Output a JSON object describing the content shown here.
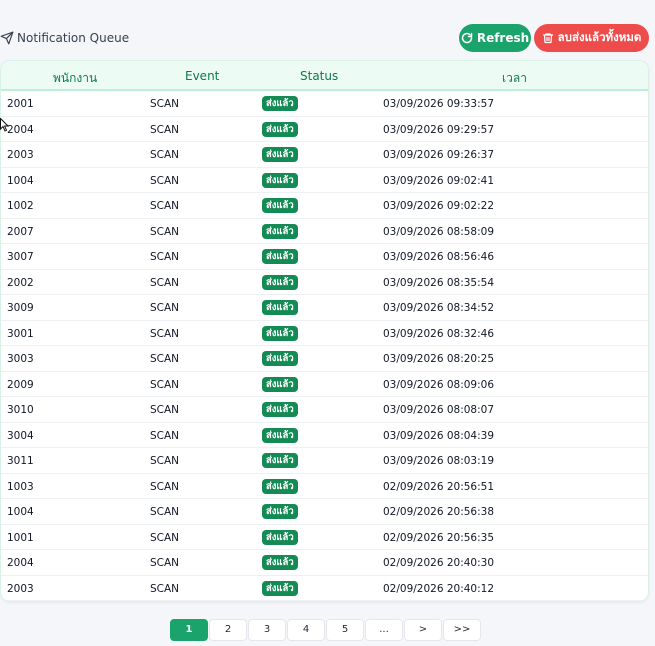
{
  "header": {
    "title": "Notification Queue",
    "refresh_label": "Refresh",
    "delete_label": "ลบส่งแล้วทั้งหมด"
  },
  "table": {
    "columns": [
      "พนักงาน",
      "Event",
      "Status",
      "เวลา"
    ],
    "rows": [
      {
        "employee": "2001",
        "event": "SCAN",
        "status": "ส่งแล้ว",
        "time": "03/09/2026 09:33:57"
      },
      {
        "employee": "2004",
        "event": "SCAN",
        "status": "ส่งแล้ว",
        "time": "03/09/2026 09:29:57"
      },
      {
        "employee": "2003",
        "event": "SCAN",
        "status": "ส่งแล้ว",
        "time": "03/09/2026 09:26:37"
      },
      {
        "employee": "1004",
        "event": "SCAN",
        "status": "ส่งแล้ว",
        "time": "03/09/2026 09:02:41"
      },
      {
        "employee": "1002",
        "event": "SCAN",
        "status": "ส่งแล้ว",
        "time": "03/09/2026 09:02:22"
      },
      {
        "employee": "2007",
        "event": "SCAN",
        "status": "ส่งแล้ว",
        "time": "03/09/2026 08:58:09"
      },
      {
        "employee": "3007",
        "event": "SCAN",
        "status": "ส่งแล้ว",
        "time": "03/09/2026 08:56:46"
      },
      {
        "employee": "2002",
        "event": "SCAN",
        "status": "ส่งแล้ว",
        "time": "03/09/2026 08:35:54"
      },
      {
        "employee": "3009",
        "event": "SCAN",
        "status": "ส่งแล้ว",
        "time": "03/09/2026 08:34:52"
      },
      {
        "employee": "3001",
        "event": "SCAN",
        "status": "ส่งแล้ว",
        "time": "03/09/2026 08:32:46"
      },
      {
        "employee": "3003",
        "event": "SCAN",
        "status": "ส่งแล้ว",
        "time": "03/09/2026 08:20:25"
      },
      {
        "employee": "2009",
        "event": "SCAN",
        "status": "ส่งแล้ว",
        "time": "03/09/2026 08:09:06"
      },
      {
        "employee": "3010",
        "event": "SCAN",
        "status": "ส่งแล้ว",
        "time": "03/09/2026 08:08:07"
      },
      {
        "employee": "3004",
        "event": "SCAN",
        "status": "ส่งแล้ว",
        "time": "03/09/2026 08:04:39"
      },
      {
        "employee": "3011",
        "event": "SCAN",
        "status": "ส่งแล้ว",
        "time": "03/09/2026 08:03:19"
      },
      {
        "employee": "1003",
        "event": "SCAN",
        "status": "ส่งแล้ว",
        "time": "02/09/2026 20:56:51"
      },
      {
        "employee": "1004",
        "event": "SCAN",
        "status": "ส่งแล้ว",
        "time": "02/09/2026 20:56:38"
      },
      {
        "employee": "1001",
        "event": "SCAN",
        "status": "ส่งแล้ว",
        "time": "02/09/2026 20:56:35"
      },
      {
        "employee": "2004",
        "event": "SCAN",
        "status": "ส่งแล้ว",
        "time": "02/09/2026 20:40:30"
      },
      {
        "employee": "2003",
        "event": "SCAN",
        "status": "ส่งแล้ว",
        "time": "02/09/2026 20:40:12"
      }
    ]
  },
  "pagination": {
    "pages": [
      "1",
      "2",
      "3",
      "4",
      "5",
      "...",
      ">",
      ">>"
    ],
    "current": "1"
  },
  "colors": {
    "accent": "#1aa36a",
    "danger": "#ee4b4b",
    "badge": "#148a55",
    "header_text": "#0f7a4c"
  },
  "icons": {
    "title": "send-icon",
    "refresh": "refresh-icon",
    "delete": "trash-icon"
  }
}
